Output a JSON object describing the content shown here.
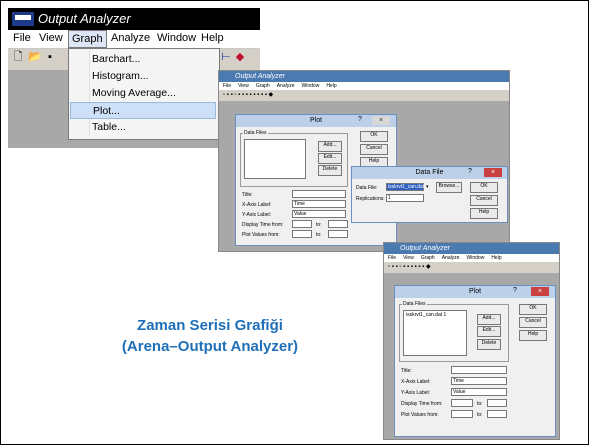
{
  "window1": {
    "title": "Output Analyzer",
    "menus": [
      "File",
      "View",
      "Graph",
      "Analyze",
      "Window",
      "Help"
    ],
    "graph_menu_items": [
      "Barchart...",
      "Histogram...",
      "Moving Average...",
      "Plot...",
      "Table..."
    ],
    "highlighted_item": "Plot..."
  },
  "window2": {
    "title": "Output Analyzer",
    "menus": [
      "File",
      "View",
      "Graph",
      "Analyze",
      "Window",
      "Help"
    ],
    "plot_dialog": {
      "title": "Plot",
      "help_mark": "?",
      "close": "×",
      "group_label": "Data Files",
      "buttons": [
        "OK",
        "Cancel",
        "Help",
        "Add...",
        "Edit...",
        "Delete"
      ],
      "fields": {
        "title_label": "Title:",
        "xaxis_label": "X-Axis Label:",
        "xaxis_value": "Time",
        "yaxis_label": "Y-Axis Label:",
        "yaxis_value": "Value",
        "display_time_label": "Display Time from:",
        "plot_values_label": "Plot Values from:",
        "to_label": "to:"
      }
    },
    "data_file_dialog": {
      "title": "Data File",
      "help_mark": "?",
      "close": "×",
      "data_file_label": "Data File:",
      "data_file_value": "isskrvt1_can.dat",
      "replications_label": "Replications:",
      "replications_value": "1",
      "browse": "Browse...",
      "ok": "OK",
      "cancel": "Cancel",
      "help": "Help"
    }
  },
  "window3": {
    "title": "Output Analyzer",
    "menus": [
      "File",
      "View",
      "Graph",
      "Analyze",
      "Window",
      "Help"
    ],
    "plot_dialog": {
      "title": "Plot",
      "help_mark": "?",
      "close": "×",
      "group_label": "Data Files",
      "list_item": "isskrvt1_can.dat 1",
      "buttons": [
        "OK",
        "Cancel",
        "Help",
        "Add...",
        "Edit...",
        "Delete"
      ],
      "fields": {
        "title_label": "Title:",
        "xaxis_label": "X-Axis Label:",
        "xaxis_value": "Time",
        "yaxis_label": "Y-Axis Label:",
        "yaxis_value": "Value",
        "display_time_label": "Display Time from:",
        "plot_values_label": "Plot Values from:",
        "to_label": "to:"
      }
    }
  },
  "caption": {
    "line1": "Zaman Serisi Grafiği",
    "line2": "(Arena–Output Analyzer)"
  },
  "colors": {
    "caption": "#1f6fb8",
    "titlebar_active": "#000000",
    "menu_highlight": "#cde0f7",
    "dialog_close": "#c84040"
  }
}
